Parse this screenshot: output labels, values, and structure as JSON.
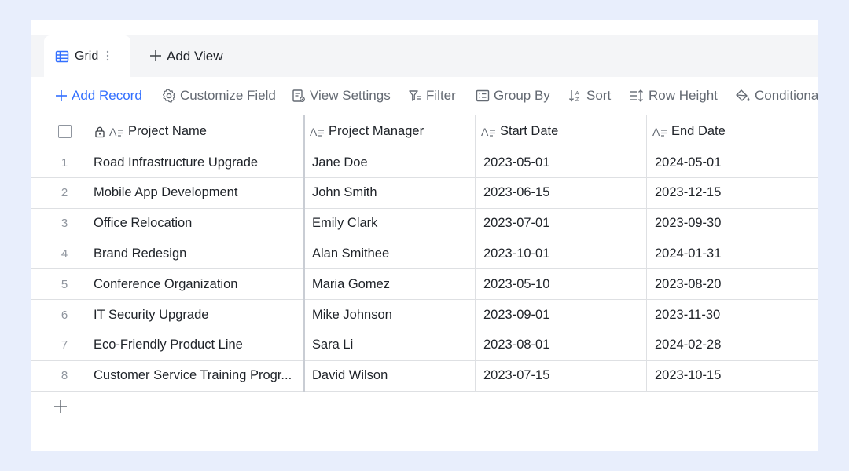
{
  "colors": {
    "accent": "#3370ff",
    "background": "#e8eefc",
    "text": "#1f2329",
    "muted": "#646a73"
  },
  "views": {
    "active_label": "Grid",
    "add_label": "Add View"
  },
  "toolbar": {
    "add_record": "Add Record",
    "customize_field": "Customize Field",
    "view_settings": "View Settings",
    "filter": "Filter",
    "group_by": "Group By",
    "sort": "Sort",
    "row_height": "Row Height",
    "conditional": "Conditional"
  },
  "columns": [
    "Project Name",
    "Project Manager",
    "Start Date",
    "End Date"
  ],
  "rows": [
    {
      "num": "1",
      "name": "Road Infrastructure Upgrade",
      "manager": "Jane Doe",
      "start": "2023-05-01",
      "end": "2024-05-01"
    },
    {
      "num": "2",
      "name": "Mobile App Development",
      "manager": "John Smith",
      "start": "2023-06-15",
      "end": "2023-12-15"
    },
    {
      "num": "3",
      "name": "Office Relocation",
      "manager": "Emily Clark",
      "start": "2023-07-01",
      "end": "2023-09-30"
    },
    {
      "num": "4",
      "name": "Brand Redesign",
      "manager": "Alan Smithee",
      "start": "2023-10-01",
      "end": "2024-01-31"
    },
    {
      "num": "5",
      "name": "Conference Organization",
      "manager": "Maria Gomez",
      "start": "2023-05-10",
      "end": "2023-08-20"
    },
    {
      "num": "6",
      "name": "IT Security Upgrade",
      "manager": "Mike Johnson",
      "start": "2023-09-01",
      "end": "2023-11-30"
    },
    {
      "num": "7",
      "name": "Eco-Friendly Product Line",
      "manager": "Sara Li",
      "start": "2023-08-01",
      "end": "2024-02-28"
    },
    {
      "num": "8",
      "name": "Customer Service Training Progr...",
      "manager": "David Wilson",
      "start": "2023-07-15",
      "end": "2023-10-15"
    }
  ]
}
